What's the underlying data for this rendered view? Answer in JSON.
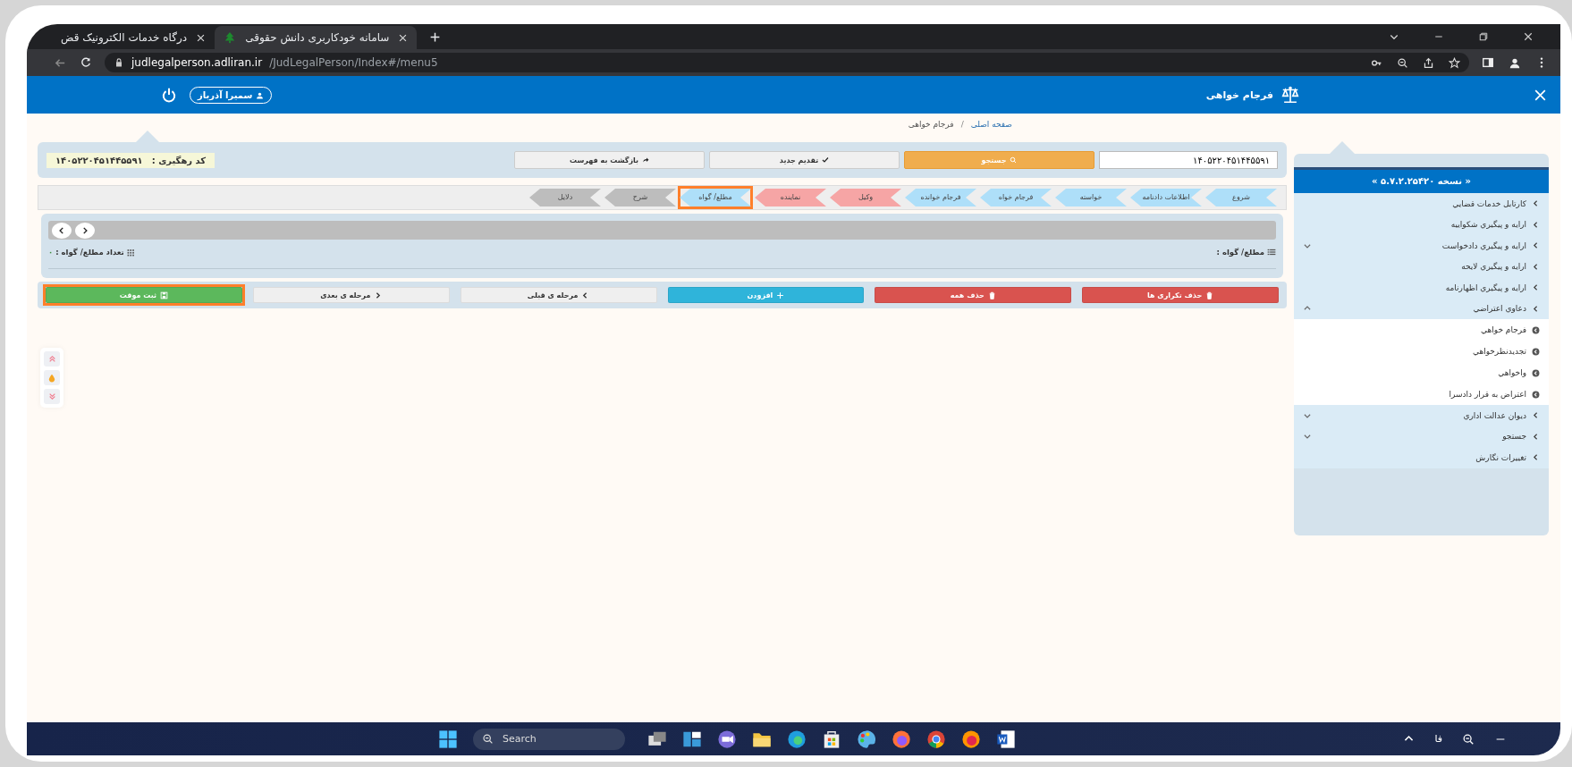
{
  "browser": {
    "tabs": [
      {
        "title": "سامانه خودکاربری دانش حقوقی",
        "selected": true
      },
      {
        "title": "درگاه خدمات الکترونیک قض",
        "selected": false
      }
    ],
    "url_host": "judlegalperson.adliran.ir",
    "url_path": "/JudLegalPerson/Index#/menu5"
  },
  "header": {
    "title": "فرجام خواهی",
    "user": "سمیرا آذرباز"
  },
  "breadcrumb": [
    "صفحه اصلی",
    "فرجام خواهی"
  ],
  "breadcrumb_separator": "/",
  "toolbar": {
    "search_value": "۱۴۰۵۲۲۰۴۵۱۴۴۵۵۹۱",
    "search_button": "جستجو",
    "new_button": "تقدیم جدید",
    "back_button": "بازگشت به فهرست",
    "tracking_label": "کد رهگیری :",
    "tracking_code": "۱۴۰۵۲۲۰۴۵۱۴۴۵۵۹۱"
  },
  "steps": [
    {
      "label": "شروع",
      "color": "#aedff9",
      "selected": false
    },
    {
      "label": "اطلاعات دادنامه",
      "color": "#aedff9",
      "selected": false
    },
    {
      "label": "خواسته",
      "color": "#aedff9",
      "selected": false
    },
    {
      "label": "فرجام خواه",
      "color": "#aedff9",
      "selected": false
    },
    {
      "label": "فرجام خوانده",
      "color": "#aedff9",
      "selected": false
    },
    {
      "label": "وکیل",
      "color": "#f6a5a5",
      "selected": false
    },
    {
      "label": "نماینده",
      "color": "#f6a5a5",
      "selected": false
    },
    {
      "label": "مطلع/ گواه",
      "color": "#aedff9",
      "selected": true
    },
    {
      "label": "شرح",
      "color": "#bdbdbd",
      "selected": false
    },
    {
      "label": "دلایل",
      "color": "#bdbdbd",
      "selected": false
    }
  ],
  "panel": {
    "title": "مطلع/ گواه :",
    "count_label": "تعداد مطلع/ گواه :",
    "count": "۰"
  },
  "bottom_buttons": [
    {
      "label": "حذف تکراری ها",
      "kind": "danger",
      "highlighted": false
    },
    {
      "label": "حذف همه",
      "kind": "danger",
      "highlighted": false
    },
    {
      "label": "افزودن",
      "kind": "info",
      "highlighted": false
    },
    {
      "label": "مرحله ی قبلی",
      "kind": "default",
      "highlighted": false
    },
    {
      "label": "مرحله ی بعدی",
      "kind": "default",
      "highlighted": false
    },
    {
      "label": "ثبت موقت",
      "kind": "success",
      "highlighted": true
    }
  ],
  "sidebar": {
    "version": "« نسخه ۵.۷.۲.۲۵۴۲۰ »",
    "items": [
      {
        "label": "کارتابل خدمات قضایي",
        "kind": "link"
      },
      {
        "label": "ارایه و پیگیري شکواییه",
        "kind": "link"
      },
      {
        "label": "ارایه و پیگیري دادخواست",
        "kind": "group",
        "expanded": false
      },
      {
        "label": "ارایه و پیگیري لایحه",
        "kind": "link"
      },
      {
        "label": "ارایه و پیگیري اظهارنامه",
        "kind": "link"
      },
      {
        "label": "دعاوي اعتراضي",
        "kind": "group",
        "expanded": true,
        "children": [
          {
            "label": "فرجام خواهي"
          },
          {
            "label": "تجدیدنظرخواهي"
          },
          {
            "label": "واخواهي"
          },
          {
            "label": "اعتراض به قرار دادسرا"
          }
        ]
      },
      {
        "label": "دیوان عدالت اداري",
        "kind": "group",
        "expanded": false
      },
      {
        "label": "جستجو",
        "kind": "group",
        "expanded": false
      },
      {
        "label": "تغییرات نگارش",
        "kind": "link"
      }
    ]
  },
  "taskbar": {
    "search_placeholder": "Search",
    "language": "فا"
  }
}
